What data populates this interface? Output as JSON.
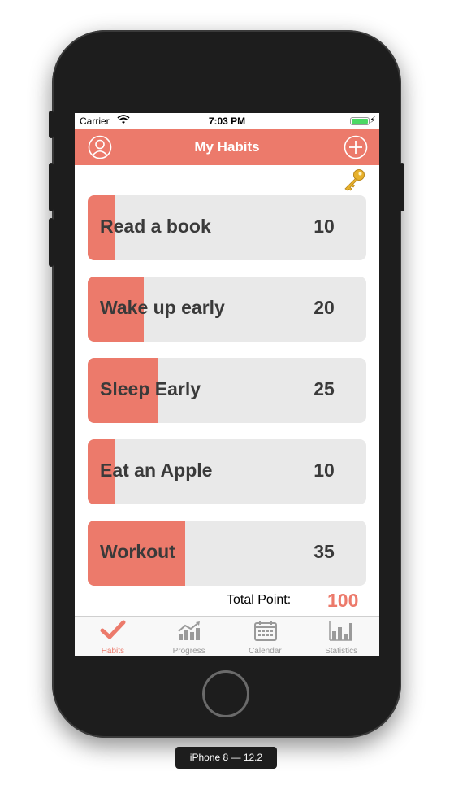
{
  "status_bar": {
    "carrier": "Carrier",
    "time": "7:03 PM"
  },
  "navbar": {
    "title": "My Habits"
  },
  "habits": [
    {
      "name": "Read a book",
      "points": "10",
      "progress": 0.1
    },
    {
      "name": "Wake up early",
      "points": "20",
      "progress": 0.2
    },
    {
      "name": "Sleep Early",
      "points": "25",
      "progress": 0.25
    },
    {
      "name": "Eat an Apple",
      "points": "10",
      "progress": 0.1
    },
    {
      "name": "Workout",
      "points": "35",
      "progress": 0.35
    }
  ],
  "total": {
    "label": "Total Point:",
    "value": "100"
  },
  "tabs": [
    {
      "label": "Habits",
      "icon": "checkmark-icon",
      "active": true
    },
    {
      "label": "Progress",
      "icon": "trending-chart-icon",
      "active": false
    },
    {
      "label": "Calendar",
      "icon": "calendar-icon",
      "active": false
    },
    {
      "label": "Statistics",
      "icon": "bar-chart-icon",
      "active": false
    }
  ],
  "device_label": "iPhone 8 — 12.2",
  "colors": {
    "accent": "#ec7a6b",
    "track": "#e9e9e9",
    "inactive": "#9a9a9a"
  }
}
